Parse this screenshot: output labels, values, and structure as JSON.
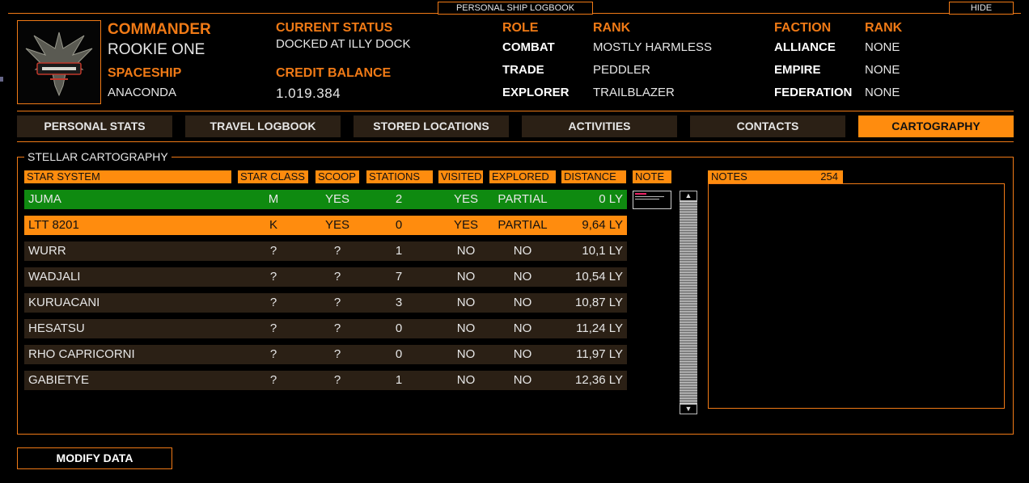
{
  "window": {
    "title": "PERSONAL SHIP LOGBOOK",
    "hide_label": "HIDE"
  },
  "commander": {
    "label": "COMMANDER",
    "name": "ROOKIE ONE",
    "spaceship_label": "SPACESHIP",
    "spaceship": "ANACONDA",
    "status_label": "CURRENT STATUS",
    "status": "DOCKED AT ILLY DOCK",
    "credit_label": "CREDIT BALANCE",
    "credit": "1.019.384",
    "logo_icon": "elite-dangerous-logo"
  },
  "roles": {
    "role_label": "ROLE",
    "rank_label": "RANK",
    "items": [
      {
        "role": "COMBAT",
        "rank": "MOSTLY HARMLESS"
      },
      {
        "role": "TRADE",
        "rank": "PEDDLER"
      },
      {
        "role": "EXPLORER",
        "rank": "TRAILBLAZER"
      }
    ]
  },
  "factions": {
    "faction_label": "FACTION",
    "rank_label": "RANK",
    "items": [
      {
        "faction": "ALLIANCE",
        "rank": "NONE"
      },
      {
        "faction": "EMPIRE",
        "rank": "NONE"
      },
      {
        "faction": "FEDERATION",
        "rank": "NONE"
      }
    ]
  },
  "tabs": [
    {
      "label": "PERSONAL STATS"
    },
    {
      "label": "TRAVEL LOGBOOK"
    },
    {
      "label": "STORED LOCATIONS"
    },
    {
      "label": "ACTIVITIES"
    },
    {
      "label": "CONTACTS"
    },
    {
      "label": "CARTOGRAPHY"
    }
  ],
  "active_tab": "CARTOGRAPHY",
  "cartography": {
    "panel_title": "STELLAR CARTOGRAPHY",
    "columns": [
      "STAR SYSTEM",
      "STAR CLASS",
      "SCOOP",
      "STATIONS",
      "VISITED",
      "EXPLORED",
      "DISTANCE",
      "NOTE"
    ],
    "rows": [
      {
        "system": "JUMA",
        "class": "M",
        "scoop": "YES",
        "stations": "2",
        "visited": "YES",
        "explored": "PARTIAL",
        "distance": "0 LY"
      },
      {
        "system": "LTT 8201",
        "class": "K",
        "scoop": "YES",
        "stations": "0",
        "visited": "YES",
        "explored": "PARTIAL",
        "distance": "9,64 LY"
      },
      {
        "system": "WURR",
        "class": "?",
        "scoop": "?",
        "stations": "1",
        "visited": "NO",
        "explored": "NO",
        "distance": "10,1 LY"
      },
      {
        "system": "WADJALI",
        "class": "?",
        "scoop": "?",
        "stations": "7",
        "visited": "NO",
        "explored": "NO",
        "distance": "10,54 LY"
      },
      {
        "system": "KURUACANI",
        "class": "?",
        "scoop": "?",
        "stations": "3",
        "visited": "NO",
        "explored": "NO",
        "distance": "10,87 LY"
      },
      {
        "system": "HESATSU",
        "class": "?",
        "scoop": "?",
        "stations": "0",
        "visited": "NO",
        "explored": "NO",
        "distance": "11,24 LY"
      },
      {
        "system": "RHO CAPRICORNI",
        "class": "?",
        "scoop": "?",
        "stations": "0",
        "visited": "NO",
        "explored": "NO",
        "distance": "11,97 LY"
      },
      {
        "system": "GABIETYE",
        "class": "?",
        "scoop": "?",
        "stations": "1",
        "visited": "NO",
        "explored": "NO",
        "distance": "12,36 LY"
      }
    ],
    "notes_label": "NOTES",
    "notes_count": "254",
    "scroll_up_icon": "arrow-up-icon",
    "scroll_down_icon": "arrow-down-icon"
  },
  "modify_label": "MODIFY DATA",
  "colors": {
    "accent": "#ff8c0e",
    "row_bg": "#2b2015",
    "row_current": "#0f8a10"
  }
}
